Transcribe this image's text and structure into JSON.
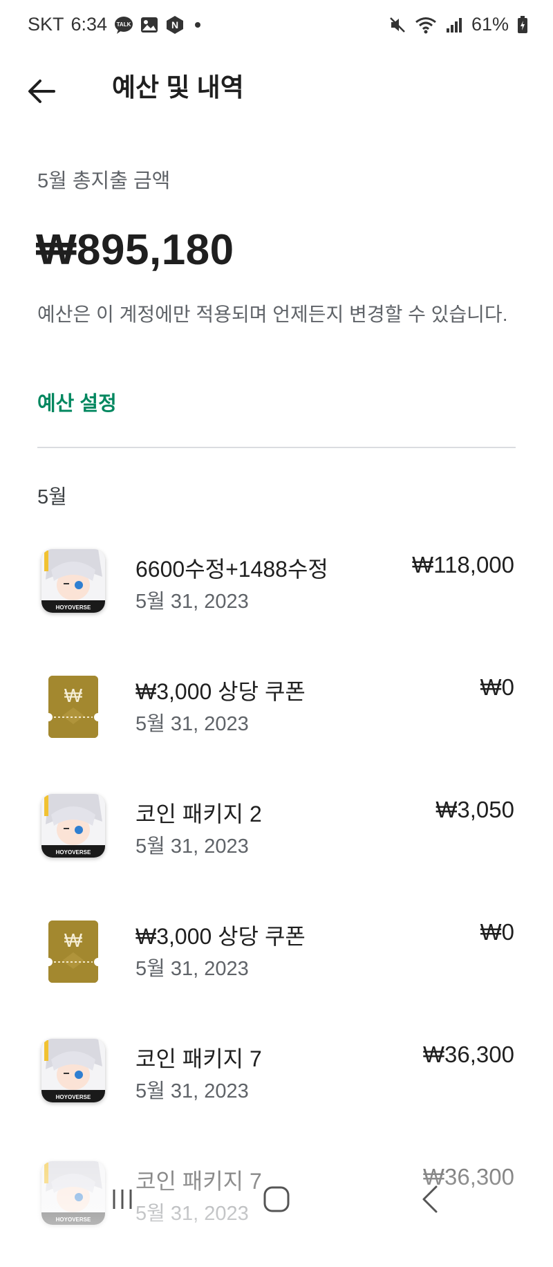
{
  "status_bar": {
    "carrier": "SKT",
    "time": "6:34",
    "notification_icons": [
      "kakaotalk-icon",
      "gallery-icon",
      "naver-icon",
      "dot-icon"
    ],
    "talk_label": "TALK",
    "naver_label": "N",
    "system_icons": [
      "mute-icon",
      "wifi-icon",
      "signal-icon",
      "battery-icon"
    ],
    "battery": "61%"
  },
  "app_bar": {
    "back_icon": "arrow-back-icon",
    "title": "예산 및 내역"
  },
  "summary": {
    "label": "5월 총지출 금액",
    "total": "₩895,180",
    "description": "예산은 이 계정에만 적용되며 언제든지 변경할 수 있습니다.",
    "budget_link": "예산 설정",
    "accent_color": "#01875f"
  },
  "month_header": "5월",
  "items": [
    {
      "icon": "hoyoverse-app-icon",
      "kind": "app",
      "title": "6600수정+1488수정",
      "date": "5월 31, 2023",
      "price": "₩118,000"
    },
    {
      "icon": "won-coupon-icon",
      "kind": "coupon",
      "coupon_symbol": "₩",
      "title": "₩3,000 상당 쿠폰",
      "date": "5월 31, 2023",
      "price": "₩0"
    },
    {
      "icon": "hoyoverse-app-icon",
      "kind": "app",
      "title": "코인 패키지 2",
      "date": "5월 31, 2023",
      "price": "₩3,050"
    },
    {
      "icon": "won-coupon-icon",
      "kind": "coupon",
      "coupon_symbol": "₩",
      "title": "₩3,000 상당 쿠폰",
      "date": "5월 31, 2023",
      "price": "₩0"
    },
    {
      "icon": "hoyoverse-app-icon",
      "kind": "app",
      "title": "코인 패키지 7",
      "date": "5월 31, 2023",
      "price": "₩36,300"
    },
    {
      "icon": "hoyoverse-app-icon",
      "kind": "app",
      "title": "코인 패키지 7",
      "date": "5월 31, 2023",
      "price": "₩36,300"
    }
  ],
  "app_icon_label": "HOYOVERSE",
  "nav_bar": {
    "buttons": [
      "recent-apps-icon",
      "home-icon",
      "back-icon"
    ]
  }
}
